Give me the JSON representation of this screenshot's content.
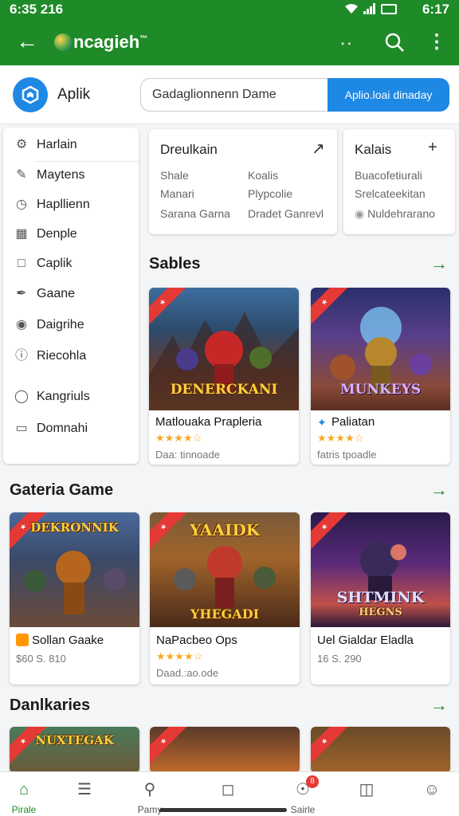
{
  "status": {
    "time_left": "6:35 216",
    "time_right": "6:17"
  },
  "appbar": {
    "title": "ncagieh",
    "title_suffix": "™"
  },
  "topbar": {
    "brand": "Aplik",
    "search_value": "Gadaglionnenn Dame",
    "search_button": "Aplio.loai dinaday"
  },
  "sidebar": {
    "items": [
      {
        "label": "Harlain",
        "icon": "settings-icon"
      },
      {
        "label": "Maytens",
        "icon": "pencil-icon"
      },
      {
        "label": "Hapllienn",
        "icon": "clock-icon"
      },
      {
        "label": "Denple",
        "icon": "calendar-icon"
      },
      {
        "label": "Caplik",
        "icon": "box-icon"
      },
      {
        "label": "Gaane",
        "icon": "pen-icon"
      },
      {
        "label": "Daigrihe",
        "icon": "eye-icon"
      },
      {
        "label": "Riecohla",
        "icon": "info-icon"
      },
      {
        "label": "Kangriuls",
        "icon": "tag-icon"
      },
      {
        "label": "Domnahi",
        "icon": "document-icon"
      }
    ]
  },
  "cards": {
    "left": {
      "head": "Dreulkain",
      "rows": [
        [
          "Shale",
          "Koalis"
        ],
        [
          "Manari",
          "Plypcolie"
        ],
        [
          "Sarana Garna",
          "Dradet Ganrevl"
        ]
      ]
    },
    "right": {
      "head": "Kalais",
      "rows": [
        "Buacofetiurali",
        "Srelcateekitan",
        "Nuldehrarano"
      ]
    }
  },
  "sections": {
    "s1": {
      "title": "Sables"
    },
    "s2": {
      "title": "Gateria Game"
    },
    "s3": {
      "title": "Danlkaries"
    }
  },
  "games": {
    "row1": [
      {
        "art_title": "DENERCKANI",
        "title": "Matlouaka Prapleria",
        "stars": "★★★★☆",
        "meta": "Daa: tinnoade"
      },
      {
        "art_title": "MUNKEYS",
        "title": "Paliatan",
        "stars": "★★★★☆",
        "meta": "fatris tpoadle"
      }
    ],
    "row2": [
      {
        "art_title": "DEKRONNIK",
        "title": "Sollan Gaake",
        "stars": "",
        "meta": "$60  S. 810"
      },
      {
        "art_title": "YAAIDK",
        "art_sub": "YHEGADI",
        "title": "NaPacbeo Ops",
        "stars": "★★★★☆",
        "meta": "Daad.:ao.ode"
      },
      {
        "art_title": "SHTMINK",
        "art_sub": "HEGNS",
        "title": "Uel Gialdar Eladla",
        "stars": "",
        "meta": "16  S. 290"
      }
    ],
    "row3": [
      {
        "art_title": "NUXTEGAK"
      },
      {
        "art_title": ""
      },
      {
        "art_title": ""
      }
    ]
  },
  "nav": {
    "items": [
      {
        "label": "Pirale",
        "icon": "home-icon"
      },
      {
        "label": "",
        "icon": "list-icon"
      },
      {
        "label": "Pamy",
        "icon": "search-icon"
      },
      {
        "label": "",
        "icon": "bag-icon"
      },
      {
        "label": "Sairle",
        "icon": "chat-icon",
        "badge": "8"
      },
      {
        "label": "",
        "icon": "folder-icon"
      },
      {
        "label": "",
        "icon": "profile-icon"
      }
    ]
  },
  "colors": {
    "brand_green": "#1f8a28",
    "accent_blue": "#1e88e5",
    "badge_red": "#e53935",
    "star": "#f9a825"
  }
}
